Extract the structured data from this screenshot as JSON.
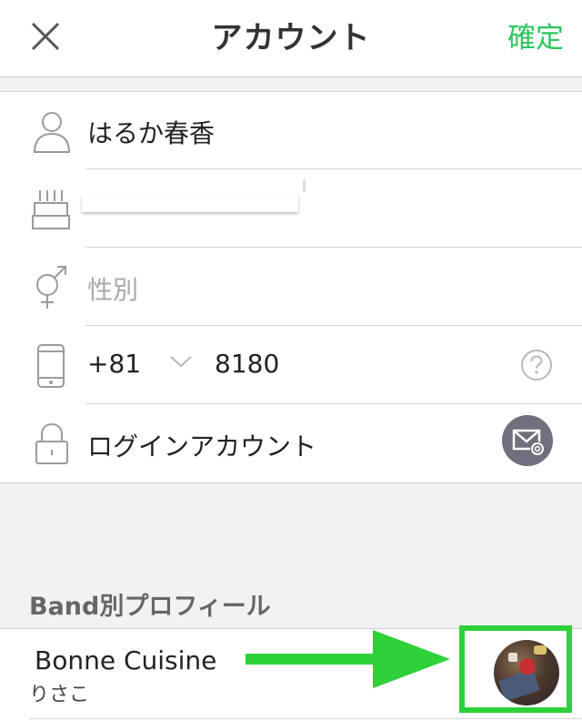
{
  "header": {
    "title": "アカウント",
    "confirm_label": "確定",
    "close_icon": "close-icon"
  },
  "account": {
    "name": "はるか春香",
    "birthday": "",
    "gender_placeholder": "性別",
    "phone": {
      "country_code": "+81",
      "number": "8180"
    },
    "login_account_label": "ログインアカウント"
  },
  "profiles_section": {
    "title": "Band別プロフィール",
    "items": [
      {
        "band_name": "Bonne Cuisine",
        "nickname": "りさこ"
      }
    ]
  },
  "colors": {
    "accent": "#2ec55f",
    "highlight": "#2ed13a",
    "mail_badge": "#6f6f7d"
  }
}
